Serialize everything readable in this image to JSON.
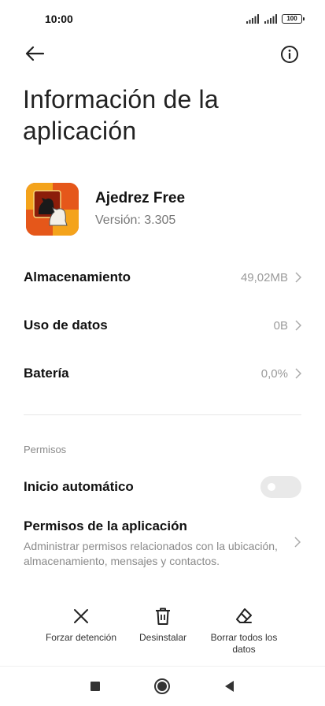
{
  "status_bar": {
    "time": "10:00",
    "battery": "100",
    "icons": [
      "signal-icon",
      "signal-icon",
      "battery-icon"
    ]
  },
  "toolbar": {
    "back_icon": "arrow-left-icon",
    "info_icon": "info-icon"
  },
  "page": {
    "title": "Información de la aplicación"
  },
  "app": {
    "name": "Ajedrez Free",
    "version": "Versión: 3.305",
    "icon": "chess-knight-icon"
  },
  "rows": [
    {
      "label": "Almacenamiento",
      "value": "49,02MB"
    },
    {
      "label": "Uso de datos",
      "value": "0B"
    },
    {
      "label": "Batería",
      "value": "0,0%"
    }
  ],
  "permissions_section": {
    "label": "Permisos",
    "autostart_label": "Inicio automático",
    "autostart_enabled": false,
    "app_permissions_title": "Permisos de la aplicación",
    "app_permissions_desc": "Administrar permisos relacionados con la ubicación, almacenamiento, mensajes y contactos."
  },
  "actions": [
    {
      "label": "Forzar detención",
      "icon": "close-icon"
    },
    {
      "label": "Desinstalar",
      "icon": "trash-icon"
    },
    {
      "label": "Borrar todos los datos",
      "icon": "eraser-icon"
    }
  ],
  "nav_bar": {
    "icons": [
      "recents-icon",
      "home-icon",
      "back-icon"
    ]
  },
  "colors": {
    "text_primary": "#111111",
    "text_secondary": "#8a8a8a",
    "toggle_off": "#e9e9e9"
  }
}
